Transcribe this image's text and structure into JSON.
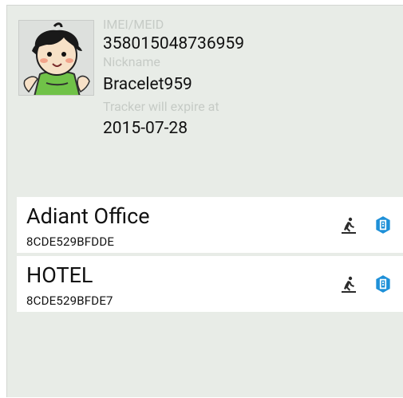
{
  "device": {
    "imei_label": "IMEI/MEID",
    "imei_value": "358015048736959",
    "nickname_label": "Nickname",
    "nickname_value": "Bracelet959",
    "expire_label": "Tracker will expire at",
    "expire_value": "2015-07-28",
    "avatar_icon": "cartoon-boy-avatar"
  },
  "locations": [
    {
      "name": "Adiant Office",
      "id": "8CDE529BFDDE",
      "icons": [
        "walking-person-icon",
        "hexagon-badge-icon"
      ]
    },
    {
      "name": "HOTEL",
      "id": "8CDE529BFDE7",
      "icons": [
        "walking-person-icon",
        "hexagon-badge-icon"
      ]
    }
  ],
  "colors": {
    "background": "#e8ece7",
    "label": "#c6cbc6",
    "text": "#111111",
    "row": "#ffffff",
    "accent": "#1e90d8"
  }
}
